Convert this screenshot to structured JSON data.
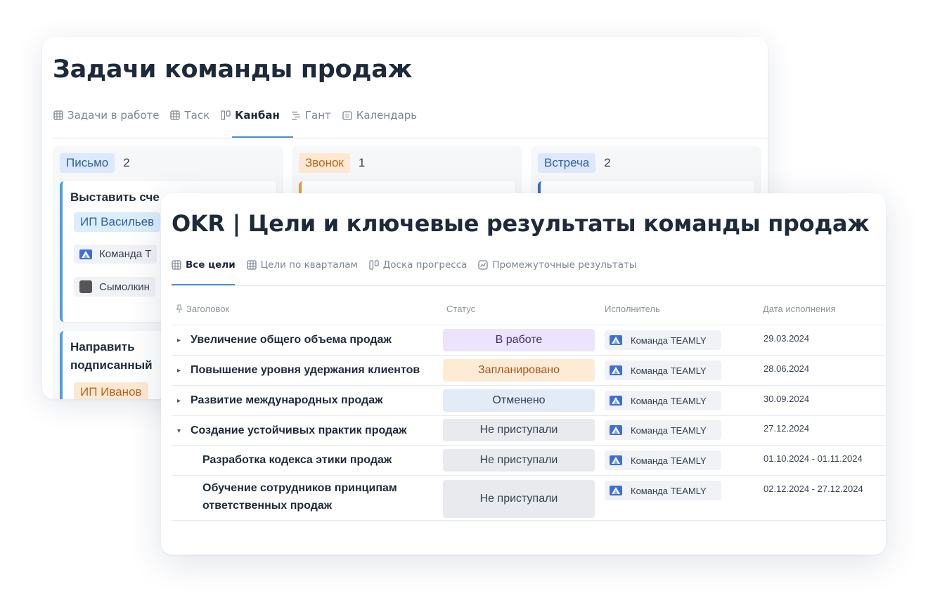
{
  "kanban": {
    "title": "Задачи команды продаж",
    "tabs": [
      {
        "label": "Задачи в работе",
        "icon": "table-icon"
      },
      {
        "label": "Таск",
        "icon": "table-icon"
      },
      {
        "label": "Канбан",
        "icon": "kanban-icon",
        "active": true
      },
      {
        "label": "Гант",
        "icon": "gantt-icon"
      },
      {
        "label": "Календарь",
        "icon": "calendar-icon"
      }
    ],
    "columns": [
      {
        "label": "Письмо",
        "count": "2",
        "color": "#4a9fde"
      },
      {
        "label": "Звонок",
        "count": "1",
        "color": "#e89a3b"
      },
      {
        "label": "Встреча",
        "count": "2",
        "color": "#2f6fcf"
      }
    ],
    "cards": [
      {
        "title": "Выставить сче",
        "tag": "ИП Васильев",
        "user1": "Команда Т",
        "user2": "Сымолкин"
      },
      {
        "title_line1": "Направить",
        "title_line2": "подписанный",
        "tag": "ИП Иванов"
      }
    ]
  },
  "okr": {
    "title": "OKR | Цели и ключевые результаты команды продаж",
    "tabs": [
      {
        "label": "Все цели",
        "icon": "table-icon",
        "active": true
      },
      {
        "label": "Цели по кварталам",
        "icon": "table-icon"
      },
      {
        "label": "Доска прогресса",
        "icon": "kanban-icon"
      },
      {
        "label": "Промежуточные результаты",
        "icon": "chart-icon"
      }
    ],
    "headers": {
      "title": "Заголовок",
      "status": "Статус",
      "assignee": "Исполнитель",
      "due": "Дата исполнения"
    },
    "rows": [
      {
        "title": "Увеличение общего объема продаж",
        "status": "В работе",
        "assignee": "Команда TEAMLY",
        "date": "29.03.2024",
        "caret": "▸"
      },
      {
        "title": "Повышение уровня удержания клиентов",
        "status": "Запланировано",
        "assignee": "Команда TEAMLY",
        "date": "28.06.2024",
        "caret": "▸"
      },
      {
        "title": "Развитие международных продаж",
        "status": "Отменено",
        "assignee": "Команда TEAMLY",
        "date": "30.09.2024",
        "caret": "▸"
      },
      {
        "title": "Создание устойчивых практик продаж",
        "status": "Не приступали",
        "assignee": "Команда TEAMLY",
        "date": "27.12.2024",
        "caret": "▾"
      },
      {
        "title": "Разработка кодекса этики продаж",
        "status": "Не приступали",
        "assignee": "Команда TEAMLY",
        "date": "01.10.2024 - 01.11.2024"
      },
      {
        "title_line1": "Обучение сотрудников принципам",
        "title_line2": "ответственных продаж",
        "status": "Не приступали",
        "assignee": "Команда TEAMLY",
        "date": "02.12.2024 - 27.12.2024"
      }
    ],
    "colors": {
      "accent": "#4a90d9",
      "in_progress": "#ece3fd",
      "planned": "#feebd6",
      "cancelled": "#e3ebf7",
      "not_started": "#e8eaed"
    }
  }
}
